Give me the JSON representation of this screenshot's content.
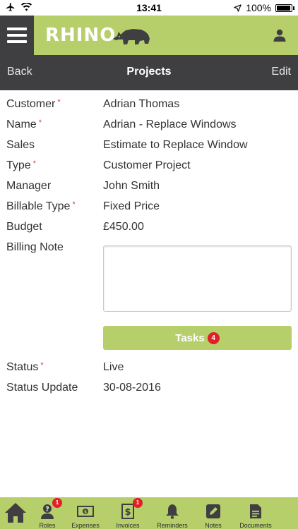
{
  "status_bar": {
    "time": "13:41",
    "battery": "100%",
    "battery_level": 1.0
  },
  "header": {
    "logo_text": "RHINO"
  },
  "navbar": {
    "back_label": "Back",
    "title": "Projects",
    "edit_label": "Edit"
  },
  "fields": [
    {
      "label": "Customer",
      "required": true,
      "value": "Adrian Thomas"
    },
    {
      "label": "Name",
      "required": true,
      "value": "Adrian - Replace Windows"
    },
    {
      "label": "Sales",
      "required": false,
      "value": "Estimate to Replace Window"
    },
    {
      "label": "Type",
      "required": true,
      "value": "Customer Project"
    },
    {
      "label": "Manager",
      "required": false,
      "value": "John Smith"
    },
    {
      "label": "Billable Type",
      "required": true,
      "value": "Fixed Price"
    },
    {
      "label": "Budget",
      "required": false,
      "value": "£450.00"
    },
    {
      "label": "Billing Note",
      "required": false,
      "value": ""
    }
  ],
  "tasks_button": {
    "label": "Tasks",
    "count": "4"
  },
  "status_fields": [
    {
      "label": "Status",
      "required": true,
      "value": "Live"
    },
    {
      "label": "Status Update",
      "required": false,
      "value": "30-08-2016"
    }
  ],
  "required_marker": "*",
  "tabbar": {
    "items": [
      {
        "label": "",
        "icon": "home-icon",
        "badge": ""
      },
      {
        "label": "Roles",
        "icon": "question-person-icon",
        "badge": "1"
      },
      {
        "label": "Expenses",
        "icon": "banknote-icon",
        "badge": ""
      },
      {
        "label": "Invoices",
        "icon": "dollar-document-icon",
        "badge": "1"
      },
      {
        "label": "Reminders",
        "icon": "bell-icon",
        "badge": ""
      },
      {
        "label": "Notes",
        "icon": "pencil-note-icon",
        "badge": ""
      },
      {
        "label": "Documents",
        "icon": "document-icon",
        "badge": ""
      }
    ]
  },
  "colors": {
    "accent": "#b6cf6b",
    "dark": "#3f3f42",
    "badge": "#e21f26",
    "required": "#e23a3a"
  }
}
